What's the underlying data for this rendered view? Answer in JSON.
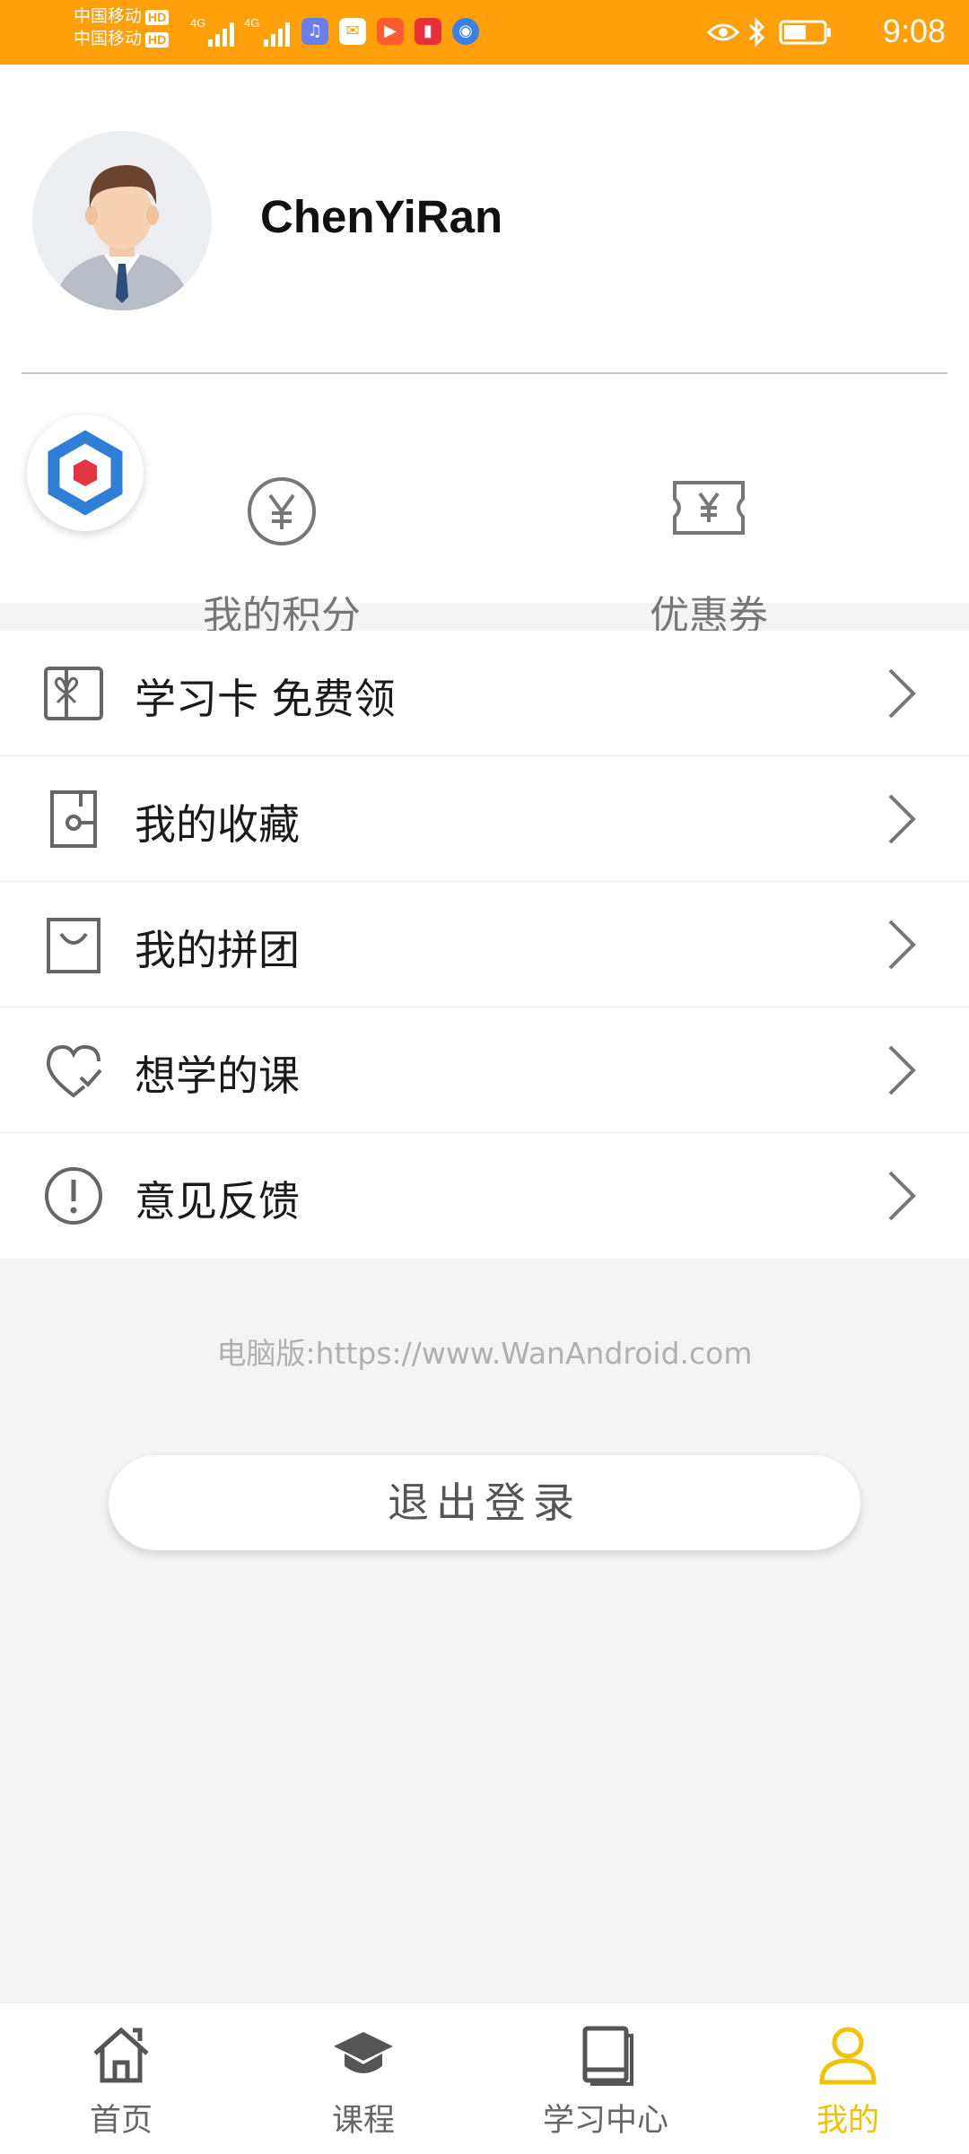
{
  "status_bar": {
    "carrier_1": "中国移动",
    "carrier_2": "中国移动",
    "hd_badge": "HD",
    "network_1": "4G",
    "network_2": "4G",
    "time": "9:08",
    "bg_color": "#ff9f0a"
  },
  "profile": {
    "username": "ChenYiRan"
  },
  "quick_actions": [
    {
      "label": "我的积分",
      "icon": "yen-coin-icon"
    },
    {
      "label": "优惠券",
      "icon": "coupon-ticket-icon"
    }
  ],
  "menu": {
    "items": [
      {
        "label": "学习卡 免费领",
        "icon": "gift-card-icon"
      },
      {
        "label": "我的收藏",
        "icon": "bookmark-icon"
      },
      {
        "label": "我的拼团",
        "icon": "shopping-bag-icon"
      },
      {
        "label": "想学的课",
        "icon": "heart-check-icon"
      },
      {
        "label": "意见反馈",
        "icon": "exclamation-circle-icon"
      }
    ]
  },
  "footer": {
    "website": "电脑版:https://www.WanAndroid.com",
    "logout_label": "退出登录"
  },
  "bottom_nav": {
    "active_color": "#f5c000",
    "items": [
      {
        "label": "首页",
        "icon": "home-icon"
      },
      {
        "label": "课程",
        "icon": "graduation-cap-icon"
      },
      {
        "label": "学习中心",
        "icon": "book-icon"
      },
      {
        "label": "我的",
        "icon": "user-icon",
        "active": true
      }
    ]
  }
}
